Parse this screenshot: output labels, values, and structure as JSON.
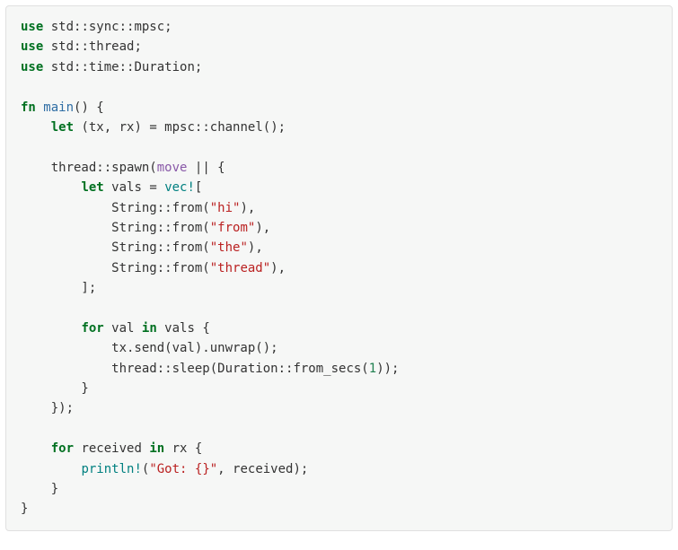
{
  "code": {
    "lines": [
      {
        "tokens": [
          {
            "cls": "k-use",
            "t": "use"
          },
          " std",
          {
            "cls": "op",
            "t": "::"
          },
          "sync",
          {
            "cls": "op",
            "t": "::"
          },
          "mpsc",
          {
            "cls": "op",
            "t": ";"
          }
        ]
      },
      {
        "tokens": [
          {
            "cls": "k-use",
            "t": "use"
          },
          " std",
          {
            "cls": "op",
            "t": "::"
          },
          "thread",
          {
            "cls": "op",
            "t": ";"
          }
        ]
      },
      {
        "tokens": [
          {
            "cls": "k-use",
            "t": "use"
          },
          " std",
          {
            "cls": "op",
            "t": "::"
          },
          "time",
          {
            "cls": "op",
            "t": "::"
          },
          "Duration",
          {
            "cls": "op",
            "t": ";"
          }
        ]
      },
      {
        "tokens": [
          ""
        ]
      },
      {
        "tokens": [
          {
            "cls": "k-fn",
            "t": "fn"
          },
          " ",
          {
            "cls": "ident-main",
            "t": "main"
          },
          "() {"
        ]
      },
      {
        "tokens": [
          "    ",
          {
            "cls": "k-let",
            "t": "let"
          },
          " (tx, rx) ",
          {
            "cls": "op",
            "t": "="
          },
          " mpsc",
          {
            "cls": "op",
            "t": "::"
          },
          "channel();"
        ]
      },
      {
        "tokens": [
          ""
        ]
      },
      {
        "tokens": [
          "    thread",
          {
            "cls": "op",
            "t": "::"
          },
          "spawn(",
          {
            "cls": "k-move",
            "t": "move"
          },
          " ",
          {
            "cls": "op",
            "t": "||"
          },
          " {"
        ]
      },
      {
        "tokens": [
          "        ",
          {
            "cls": "k-let",
            "t": "let"
          },
          " vals ",
          {
            "cls": "op",
            "t": "="
          },
          " ",
          {
            "cls": "ident-vec",
            "t": "vec!"
          },
          "["
        ]
      },
      {
        "tokens": [
          "            String",
          {
            "cls": "op",
            "t": "::"
          },
          "from(",
          {
            "cls": "string",
            "t": "\"hi\""
          },
          "),"
        ]
      },
      {
        "tokens": [
          "            String",
          {
            "cls": "op",
            "t": "::"
          },
          "from(",
          {
            "cls": "string",
            "t": "\"from\""
          },
          "),"
        ]
      },
      {
        "tokens": [
          "            String",
          {
            "cls": "op",
            "t": "::"
          },
          "from(",
          {
            "cls": "string",
            "t": "\"the\""
          },
          "),"
        ]
      },
      {
        "tokens": [
          "            String",
          {
            "cls": "op",
            "t": "::"
          },
          "from(",
          {
            "cls": "string",
            "t": "\"thread\""
          },
          "),"
        ]
      },
      {
        "tokens": [
          "        ];"
        ]
      },
      {
        "tokens": [
          ""
        ]
      },
      {
        "tokens": [
          "        ",
          {
            "cls": "k-for",
            "t": "for"
          },
          " val ",
          {
            "cls": "k-in",
            "t": "in"
          },
          " vals {"
        ]
      },
      {
        "tokens": [
          "            tx.send(val).unwrap();"
        ]
      },
      {
        "tokens": [
          "            thread",
          {
            "cls": "op",
            "t": "::"
          },
          "sleep(Duration",
          {
            "cls": "op",
            "t": "::"
          },
          "from_secs(",
          {
            "cls": "num",
            "t": "1"
          },
          "));"
        ]
      },
      {
        "tokens": [
          "        }"
        ]
      },
      {
        "tokens": [
          "    });"
        ]
      },
      {
        "tokens": [
          ""
        ]
      },
      {
        "tokens": [
          "    ",
          {
            "cls": "k-for",
            "t": "for"
          },
          " received ",
          {
            "cls": "k-in",
            "t": "in"
          },
          " rx {"
        ]
      },
      {
        "tokens": [
          "        ",
          {
            "cls": "ident-println",
            "t": "println!"
          },
          "(",
          {
            "cls": "string",
            "t": "\"Got: {}\""
          },
          ", received);"
        ]
      },
      {
        "tokens": [
          "    }"
        ]
      },
      {
        "tokens": [
          "}"
        ]
      }
    ]
  }
}
